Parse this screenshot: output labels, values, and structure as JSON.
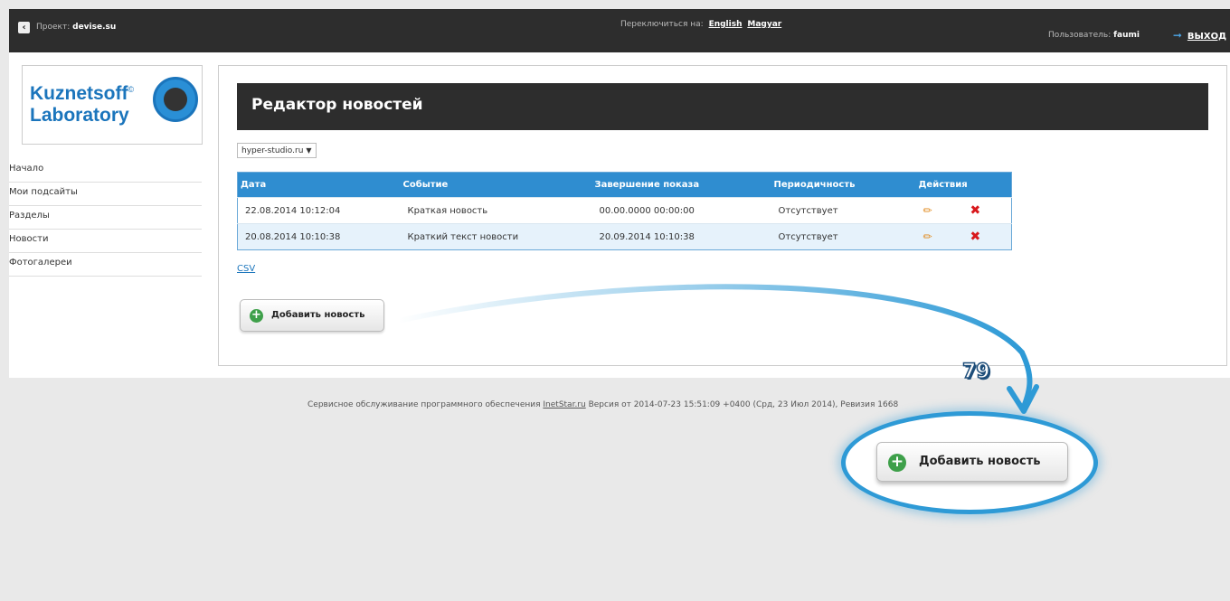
{
  "topbar": {
    "project_label": "Проект:",
    "project_name": "devise.su",
    "switch_label": "Переключиться на:",
    "lang_english": "English",
    "lang_magyar": "Magyar",
    "user_label": "Пользователь:",
    "user_name": "faumi",
    "logout": "ВЫХОД"
  },
  "logo": {
    "line1": "Kuznetsoff",
    "line2": "Laboratory",
    "reg": "©"
  },
  "sidebar": {
    "items": [
      {
        "label": "Начало"
      },
      {
        "label": "Мои подсайты"
      },
      {
        "label": "Разделы"
      },
      {
        "label": "Новости"
      },
      {
        "label": "Фотогалереи"
      }
    ]
  },
  "main": {
    "title": "Редактор новостей",
    "site_select": "hyper-studio.ru",
    "columns": [
      "Дата",
      "Событие",
      "Завершение показа",
      "Периодичность",
      "Действия"
    ],
    "rows": [
      {
        "date": "22.08.2014 10:12:04",
        "event": "Краткая новость",
        "end": "00.00.0000 00:00:00",
        "period": "Отсутствует"
      },
      {
        "date": "20.08.2014 10:10:38",
        "event": "Краткий текст новости",
        "end": "20.09.2014 10:10:38",
        "period": "Отсутствует"
      }
    ],
    "csv": "CSV",
    "add_button": "Добавить новость"
  },
  "footer": {
    "text_before": "Сервисное обслуживание программного обеспечения",
    "link": "InetStar.ru",
    "text_after": "Версия от 2014-07-23 15:51:09 +0400 (Срд, 23 Июл 2014), Ревизия 1668"
  },
  "annotation": {
    "step_number": "79",
    "button_zoom": "Добавить новость",
    "accent": "#2e9ad6"
  },
  "icons": {
    "back": "chevron-left-icon",
    "logout": "arrow-right-icon",
    "edit": "pencil-icon",
    "delete": "close-icon",
    "add": "plus-icon"
  }
}
